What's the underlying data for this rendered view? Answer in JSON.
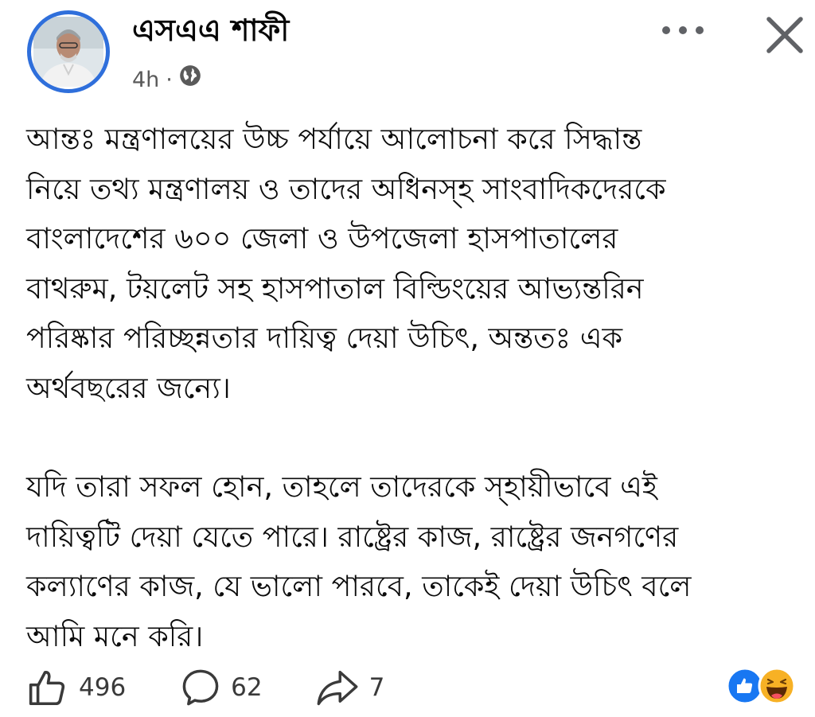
{
  "post": {
    "author_name": "এসএএ শাফী",
    "timestamp": "4h",
    "separator": "·",
    "privacy_icon": "globe-icon",
    "header_icons": {
      "more": "more-horizontal-icon",
      "close": "close-icon"
    },
    "body_paragraphs": [
      [
        "আন্তঃ মন্ত্রণালয়ের উচ্চ পর্যায়ে আলোচনা করে সিদ্ধান্ত",
        "নিয়ে তথ্য মন্ত্রণালয় ও তাদের অধিনস্হ সাংবাদিকদেরকে",
        "বাংলাদেশের ৬০০ জেলা ও উপজেলা হাসপাতালের",
        "বাথরুম, টয়লেট সহ হাসপাতাল বিল্ডিংয়ের আভ্যন্তরিন",
        "পরিষ্কার পরিচ্ছন্নতার দায়িত্ব দেয়া উচিৎ, অন্ততঃ এক",
        "অর্থবছরের জন্যে।"
      ],
      [
        "যদি তারা সফল হোন, তাহলে তাদেরকে স্হায়ীভাবে এই",
        "দায়িত্বটি দেয়া যেতে পারে। রাষ্ট্রের কাজ, রাষ্ট্রের জনগণের",
        "কল্যাণের কাজ, যে ভালো পারবে, তাকেই দেয়া উচিৎ বলে",
        "আমি মনে করি।"
      ]
    ]
  },
  "actions": {
    "like_count": "496",
    "comment_count": "62",
    "share_count": "7",
    "icons": {
      "like": "thumbs-up-icon",
      "comment": "comment-bubble-icon",
      "share": "share-arrow-icon"
    }
  },
  "reactions": {
    "types": [
      "like",
      "haha"
    ],
    "colors": {
      "like": "#1877f2",
      "haha": "#f7b125"
    }
  },
  "colors": {
    "avatar_ring": "#2f6fdb",
    "text": "#0b0b0b",
    "muted": "#5a5a5a"
  }
}
